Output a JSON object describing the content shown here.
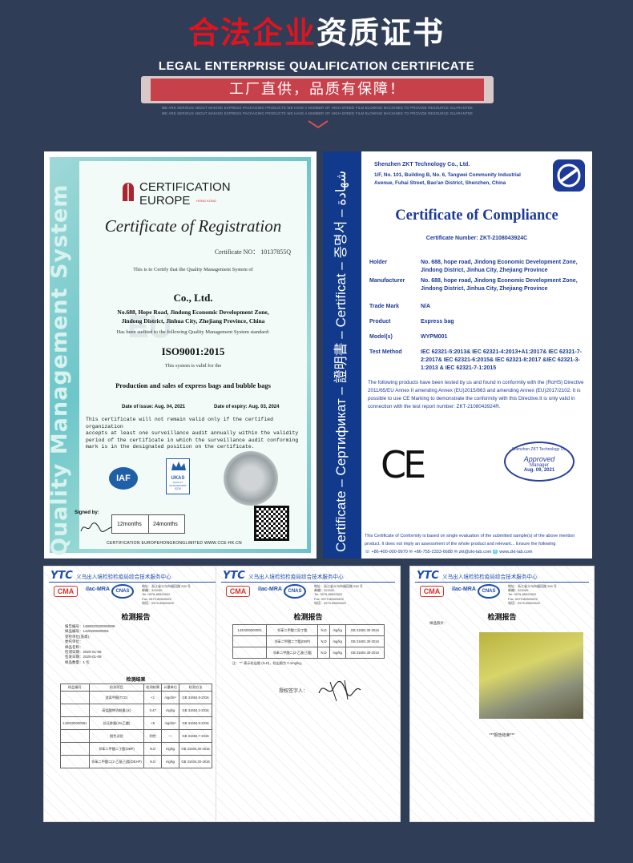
{
  "header": {
    "title_red": "合法企业",
    "title_white": "资质证书",
    "subtitle": "LEGAL ENTERPRISE QUALIFICATION CERTIFICATE",
    "banner": "工厂直供，品质有保障！",
    "fine_line_1": "WE ARE SERIOUS ABOUT MAKING EXPRESS PACKAGING PRODUCTS WE HAVE A NUMBER OF HIGH-SPEED FILM BLOWING MACHINES TO PROVIDE RESOURCE GUARANTEE",
    "fine_line_2": "WE ARE SERIOUS ABOUT MAKING EXPRESS PACKAGING PRODUCTS WE HAVE A NUMBER OF HIGH-SPEED FILM BLOWING MACHINES TO PROVIDE RESOURCE GUARANTEE"
  },
  "cert_eu": {
    "org_line1": "CERTIFICATION",
    "org_line2": "EUROPE",
    "org_tag": "HONG KONG",
    "heading": "Certificate of Registration",
    "cert_no": "Certificate NO： 10137855Q",
    "certify": "This is to Certify that the Quality Management System of",
    "company": "Co., Ltd.",
    "address1": "No.688, Hope Road, Jindong Economic Development Zone,",
    "address2": "Jindong District, Jinhua City, Zhejiang Province, China",
    "audited": "Has been audited to the following Quality Management System standard:",
    "standard": "ISO9001:2015",
    "valid_for": "This system is valid for the",
    "scope": "Production and sales of express bags and bubble bags",
    "issue": "Date of issue: Aug. 04, 2021",
    "expiry": "Date of expiry: Aug. 03, 2024",
    "note": [
      "This certificate will not remain valid only if the certified organization",
      "accepts at least one surveillance audit annually within the validity",
      "period of the certificate in which the surveillance audit conforming",
      "mark is in the designated position on the certificate."
    ],
    "side_text": "Quality Management System",
    "signed_by": "Signed by:",
    "box1": "12months",
    "box2": "24months",
    "footer": "CERTIFICATION EUROPEHONGKONGLIMITED   WWW.CCE-HK.CN",
    "iaf": "IAF",
    "ukas": "UKAS",
    "ukas_sub": "QUALITY MANAGEMENT",
    "ukas_no": "0219",
    "watermark": "EU"
  },
  "cert_ce": {
    "side_text": "Certificate – Сертификат – 證明書 – Certificat – 증명서 – شهادة",
    "company": "Shenzhen ZKT Technology Co., Ltd.",
    "addr1": "1/F, No. 101, Building B, No. 6, Tangwei Community Industrial",
    "addr2": "Avenue, Fuhai Street, Bao'an District, Shenzhen, China",
    "heading": "Certificate of Compliance",
    "number": "Certificate Number: ZKT-2108043924C",
    "rows": [
      {
        "label": "Holder",
        "value": "No. 688, hope road, Jindong Economic Development Zone, Jindong District, Jinhua City, Zhejiang Province"
      },
      {
        "label": "Manufacturer",
        "value": "No. 688, hope road, Jindong Economic Development Zone, Jindong District, Jinhua City, Zhejiang Province"
      },
      {
        "label": "Trade Mark",
        "value": "N/A"
      },
      {
        "label": "Product",
        "value": "Express bag"
      },
      {
        "label": "Model(s)",
        "value": "WYPM001"
      },
      {
        "label": "Test Method",
        "value": "IEC 62321-5:2013& IEC 62321-4:2013+A1:2017& IEC 62321-7-2:2017& IEC 62321-6:2015& IEC 62321-8:2017 &IEC 62321-3-1:2013 & IEC 62321-7-1:2015"
      }
    ],
    "body": "The following products have been tested by us and found in conformity with the (RoHS) Directive 2011/65/EU Annex II amending Annex (EU)2015/863 and amending Annex (EU)2017/2102. It is possible to use CE Marking to demonstrate the conformity with this Directive.It is only valid in connection with the test report number: ZKT-2108043924R.",
    "ce": "CE",
    "stamp_top": "Shenzhen ZKT Technology Co.",
    "stamp_mid": "Approved",
    "stamp_sub": "Manager",
    "stamp_date": "Aug. 09, 2021",
    "footer1": "This Certificate of Conformity is based on single evaluation of the submitted sample(s) of the above mention",
    "footer2": "product. It does not imply an assessment of the whole product and relevant... Ensure the following",
    "footer3": "☏ +86-400-000-9970   ✉ +86-755-2333-6688   ✉ zkt@zkt-lab.com   🌐 www.zkt-lab.com"
  },
  "reports": {
    "logo": "YTC",
    "org": "义乌出入境检验检疫局综合技术服务中心",
    "ma": "CMA",
    "ilac": "ilac-MRA",
    "cnas": "CNAS",
    "addr": [
      "地址：浙江省义乌市福田路 299 号",
      "邮编：322000",
      "Tel: 0579-85520022",
      "Fax: 0579-85520822",
      "电话：0579-85520822"
    ],
    "title": "检测报告",
    "r1_info": [
      "报告编号：1499020200000008",
      "样品编号：1420200000091",
      "受检单位(盖章)：",
      "委托单位：",
      "样品名称：",
      "检测日期：2020-01-06",
      "签发日期：2020-01-09",
      "样品数量：1 包"
    ],
    "r1_section": "检测结果",
    "r1_headers": [
      "样品编号",
      "检测项目",
      "检测结果",
      "计量单位",
      "检测方法"
    ],
    "r1_rows": [
      [
        "",
        "游离甲醛(TCE)",
        "<1",
        "mg/dm²",
        "GB 31604.8-2016"
      ],
      [
        "",
        "高锰酸钾消耗量(水)",
        "0.47",
        "mg/kg",
        "GB 31604.2-2016"
      ],
      [
        "1420200000091",
        "总迁移量(4%乙酸)",
        "<5",
        "mg/dm²",
        "GB 31604.8-2016"
      ],
      [
        "",
        "脱色试验",
        "阴性",
        "—",
        "GB 31604.7-2016"
      ],
      [
        "",
        "邻苯二甲酸二丁酯(DBP)",
        "N.D",
        "mg/kg",
        "GB 31604.30-2016"
      ],
      [
        "",
        "邻苯二甲酸二(2-乙基己)酯(DEHP)",
        "N.D",
        "mg/kg",
        "GB 31604.30-2016"
      ]
    ],
    "r2_rows": [
      [
        "1420200000091",
        "邻苯二甲酸二异丁酯",
        "N.D",
        "mg/kg",
        "GB 31604.30-2016"
      ],
      [
        "",
        "邻苯二甲酸二丁酯(DBP)",
        "N.D",
        "mg/kg",
        "GB 31604.30-2016"
      ],
      [
        "",
        "邻苯二甲酸二(2-乙基己)酯",
        "N.D",
        "mg/kg",
        "GB 31604.30-2016"
      ]
    ],
    "r2_note": "注：\"*\" 表示检出限 (N.D)，检出限为 0.1mg/kg。",
    "r2_sign": "授权签字人：",
    "r3_label": "样品照片：",
    "r3_end": "***报告结束***",
    "watermark": "YWTC"
  }
}
